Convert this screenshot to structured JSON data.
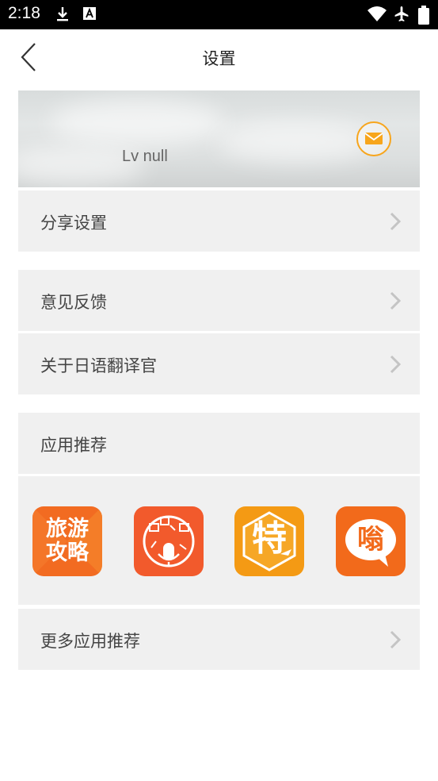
{
  "status": {
    "time": "2:18"
  },
  "header": {
    "title": "设置"
  },
  "profile": {
    "level": "Lv null"
  },
  "menu": {
    "share": "分享设置",
    "feedback": "意见反馈",
    "about": "关于日语翻译官",
    "recommend_header": "应用推荐",
    "more_apps": "更多应用推荐"
  },
  "apps": [
    {
      "icon": "travel-guide-app-icon",
      "line1": "旅游",
      "line2": "攻略",
      "color": "#f26b21"
    },
    {
      "icon": "voice-translate-app-icon",
      "color": "#f25a2c"
    },
    {
      "icon": "special-deals-app-icon",
      "line1": "特",
      "color": "#f49a14"
    },
    {
      "icon": "chat-app-icon",
      "text": "嗡",
      "color": "#f26a1b"
    }
  ],
  "colors": {
    "accent": "#f7a51c",
    "row_bg": "#f0f0f0"
  }
}
